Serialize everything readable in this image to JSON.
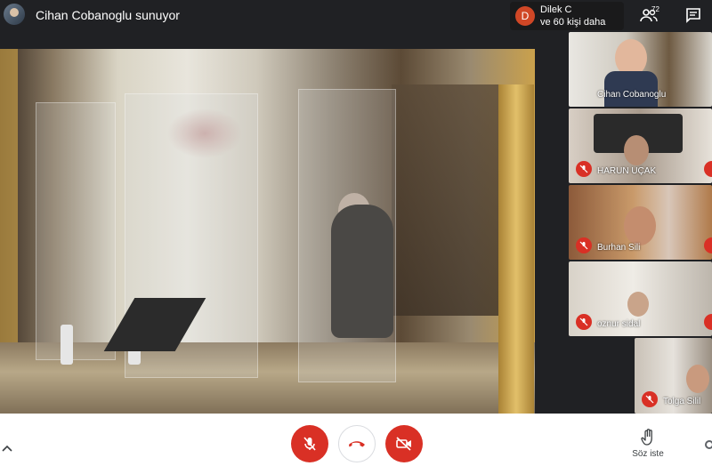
{
  "header": {
    "presenting_title": "Cihan Cobanoglu sunuyor",
    "active_speaker": {
      "avatar_letter": "D",
      "name": "Dilek C",
      "more": "ve 60 kişi daha",
      "avatar_color": "#d04726"
    },
    "people_count": "72"
  },
  "participants": [
    {
      "name": "Cihan Cobanoglu",
      "muted": false
    },
    {
      "name": "HARUN UÇAK",
      "muted": true
    },
    {
      "name": "Burhan Sili",
      "muted": true
    },
    {
      "name": "oznur sidal",
      "muted": true
    },
    {
      "name": "Tolga Silil",
      "muted": true
    }
  ],
  "controls": {
    "raise_hand_label": "Söz iste"
  },
  "icons": [
    "people-icon",
    "chat-icon",
    "mic-off-icon",
    "call-end-icon",
    "camera-off-icon",
    "hand-icon",
    "chevron-up-icon"
  ],
  "colors": {
    "danger": "#d93025",
    "background": "#202124",
    "bar": "#ffffff"
  }
}
